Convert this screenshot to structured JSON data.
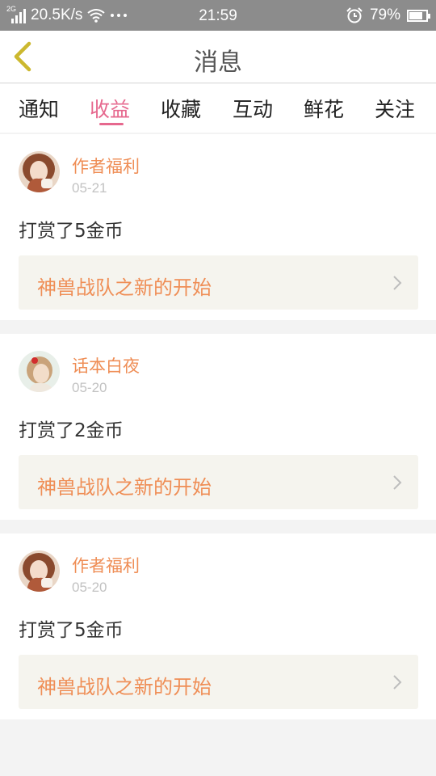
{
  "status_bar": {
    "network_tag": "2G",
    "speed": "20.5K/s",
    "time": "21:59",
    "battery": "79%",
    "battery_level": 0.79,
    "icons": [
      "signal-icon",
      "wifi-icon",
      "more-dots-icon",
      "alarm-icon",
      "battery-icon"
    ]
  },
  "nav": {
    "title": "消息",
    "back_icon": "chevron-left-icon"
  },
  "tabs": [
    {
      "label": "通知"
    },
    {
      "label": "收益",
      "active": true
    },
    {
      "label": "收藏"
    },
    {
      "label": "互动"
    },
    {
      "label": "鲜花"
    },
    {
      "label": "关注"
    }
  ],
  "colors": {
    "accent": "#e6688e",
    "name": "#ef8e56",
    "status_bar": "#8c8c8c"
  },
  "messages": [
    {
      "name": "作者福利",
      "date": "05-21",
      "text": "打赏了5金币",
      "work": "神兽战队之新的开始"
    },
    {
      "name": "话本白夜",
      "date": "05-20",
      "text": "打赏了2金币",
      "work": "神兽战队之新的开始"
    },
    {
      "name": "作者福利",
      "date": "05-20",
      "text": "打赏了5金币",
      "work": "神兽战队之新的开始"
    }
  ]
}
